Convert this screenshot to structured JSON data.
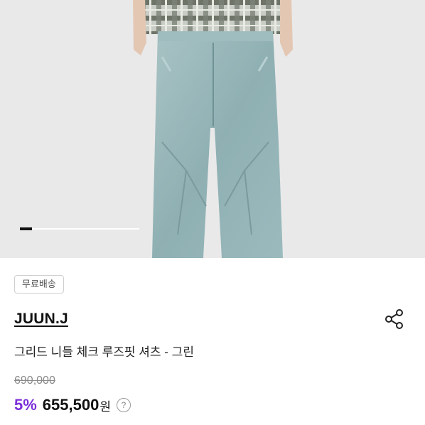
{
  "product": {
    "shipping_badge": "무료배송",
    "brand": "JUUN.J",
    "title": "그리드 니들 체크 루즈핏 셔츠 - 그린",
    "original_price": "690,000",
    "discount": "5%",
    "price": "655,500",
    "currency": "원",
    "help_symbol": "?"
  },
  "gallery": {
    "progress": 0.1
  },
  "icons": {
    "share": "share-icon",
    "help": "question-circle-icon"
  },
  "colors": {
    "discount": "#7b2fd8",
    "hero_bg": "#e9e9e9"
  }
}
